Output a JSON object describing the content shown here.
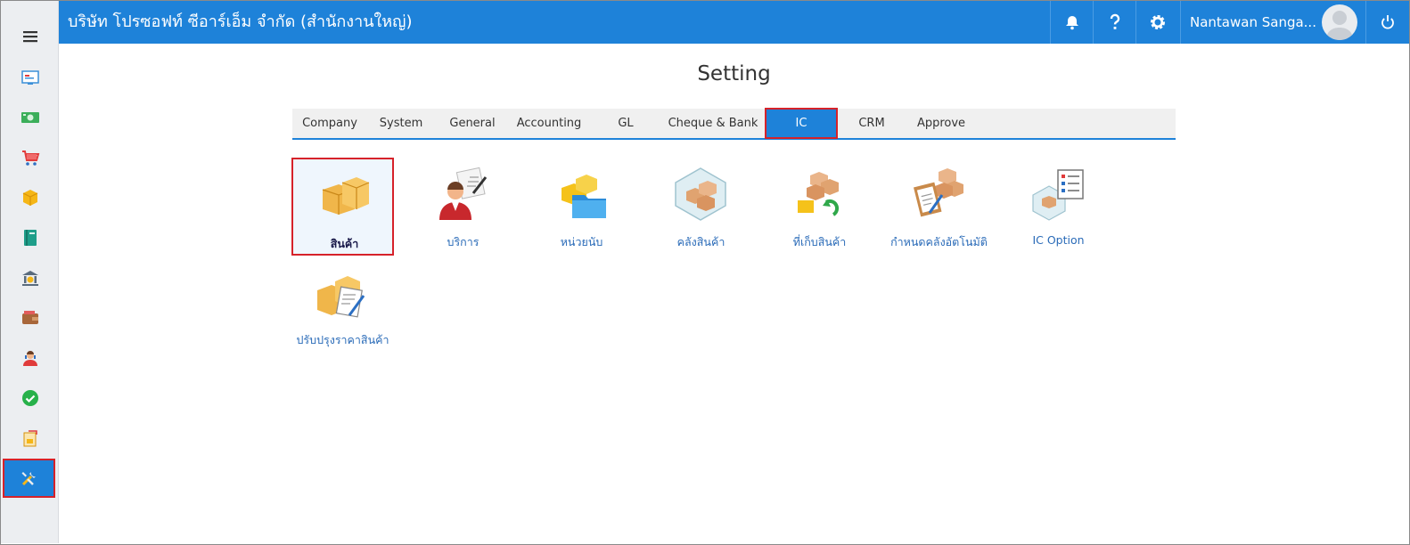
{
  "header": {
    "company_name": "บริษัท โปรซอฟท์ ซีอาร์เอ็ม จำกัด (สำนักงานใหญ่)",
    "user_name": "Nantawan Sanga..."
  },
  "page": {
    "title": "Setting"
  },
  "tabs": [
    {
      "label": "Company"
    },
    {
      "label": "System"
    },
    {
      "label": "General"
    },
    {
      "label": "Accounting"
    },
    {
      "label": "GL"
    },
    {
      "label": "Cheque & Bank"
    },
    {
      "label": "IC"
    },
    {
      "label": "CRM"
    },
    {
      "label": "Approve"
    }
  ],
  "active_tab": "IC",
  "items": [
    {
      "label": "สินค้า",
      "icon": "product-boxes-icon"
    },
    {
      "label": "บริการ",
      "icon": "service-agent-icon"
    },
    {
      "label": "หน่วยนับ",
      "icon": "unit-folder-icon"
    },
    {
      "label": "คลังสินค้า",
      "icon": "warehouse-icon"
    },
    {
      "label": "ที่เก็บสินค้า",
      "icon": "storage-location-icon"
    },
    {
      "label": "กำหนดคลังอัตโนมัติ",
      "icon": "auto-warehouse-icon"
    },
    {
      "label": "IC Option",
      "icon": "ic-option-icon"
    },
    {
      "label": "ปรับปรุงราคาสินค้า",
      "icon": "price-adjust-icon"
    }
  ],
  "selected_item": "สินค้า",
  "sidebar": [
    "menu-icon",
    "dashboard-icon",
    "money-icon",
    "cart-icon",
    "box-icon",
    "book-icon",
    "bank-icon",
    "wallet-icon",
    "contact-icon",
    "approve-icon",
    "report-icon",
    "settings-tools-icon"
  ],
  "colors": {
    "accent": "#1e82d9",
    "highlight_border": "#d6222a",
    "link": "#2a6bb8"
  }
}
